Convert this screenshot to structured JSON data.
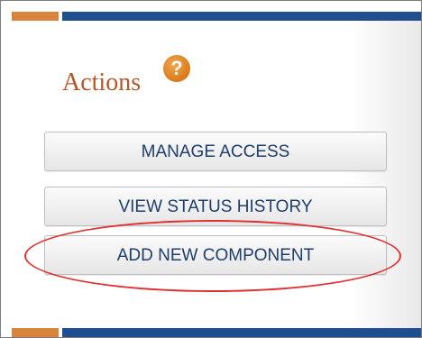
{
  "actions_panel": {
    "title": "Actions",
    "help_icon": "?",
    "buttons": [
      {
        "label": "MANAGE ACCESS"
      },
      {
        "label": "VIEW STATUS HISTORY"
      },
      {
        "label": "ADD NEW COMPONENT"
      }
    ]
  },
  "colors": {
    "accent_orange": "#d9843d",
    "brand_blue": "#1f4f8f",
    "title_color": "#b5562b",
    "button_text": "#1e3e6b",
    "highlight_red": "#e03030"
  },
  "icons": {
    "help": "question-circle-icon"
  }
}
